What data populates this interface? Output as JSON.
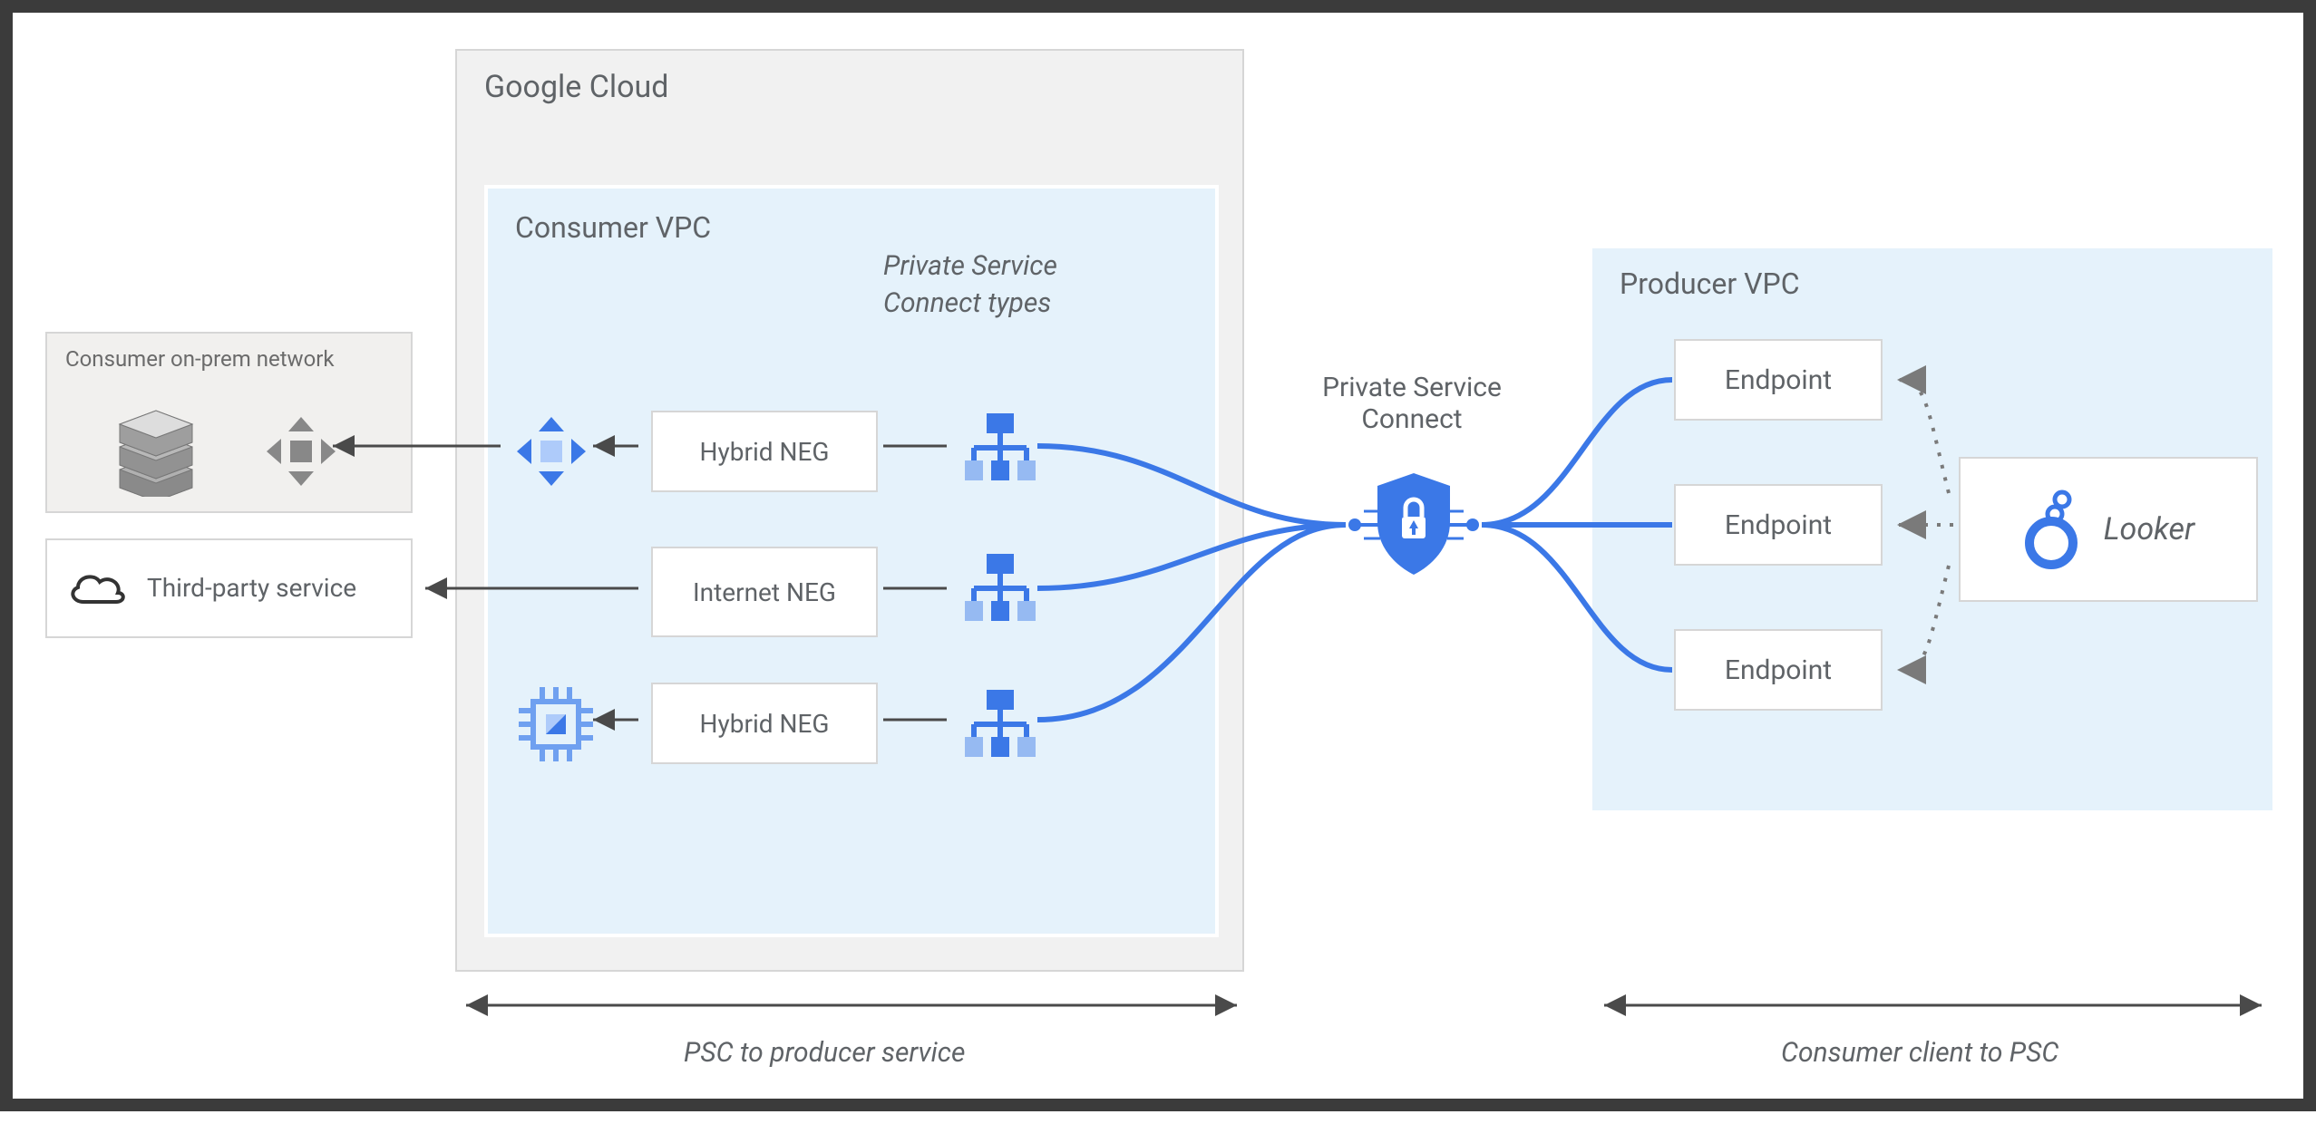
{
  "onprem": {
    "title": "Consumer on-prem network"
  },
  "gcloud": {
    "title": "Google Cloud"
  },
  "cvpc": {
    "title": "Consumer VPC",
    "psc_types_label": "Private Service Connect types",
    "neg1": "Hybrid NEG",
    "neg2": "Internet NEG",
    "neg3": "Hybrid NEG"
  },
  "third_party": {
    "label": "Third-party service"
  },
  "psc": {
    "label": "Private Service Connect"
  },
  "pvpc": {
    "title": "Producer VPC",
    "endpoint1": "Endpoint",
    "endpoint2": "Endpoint",
    "endpoint3": "Endpoint"
  },
  "looker": {
    "label": "Looker"
  },
  "bottom": {
    "left": "PSC to producer service",
    "right": "Consumer client to PSC"
  }
}
